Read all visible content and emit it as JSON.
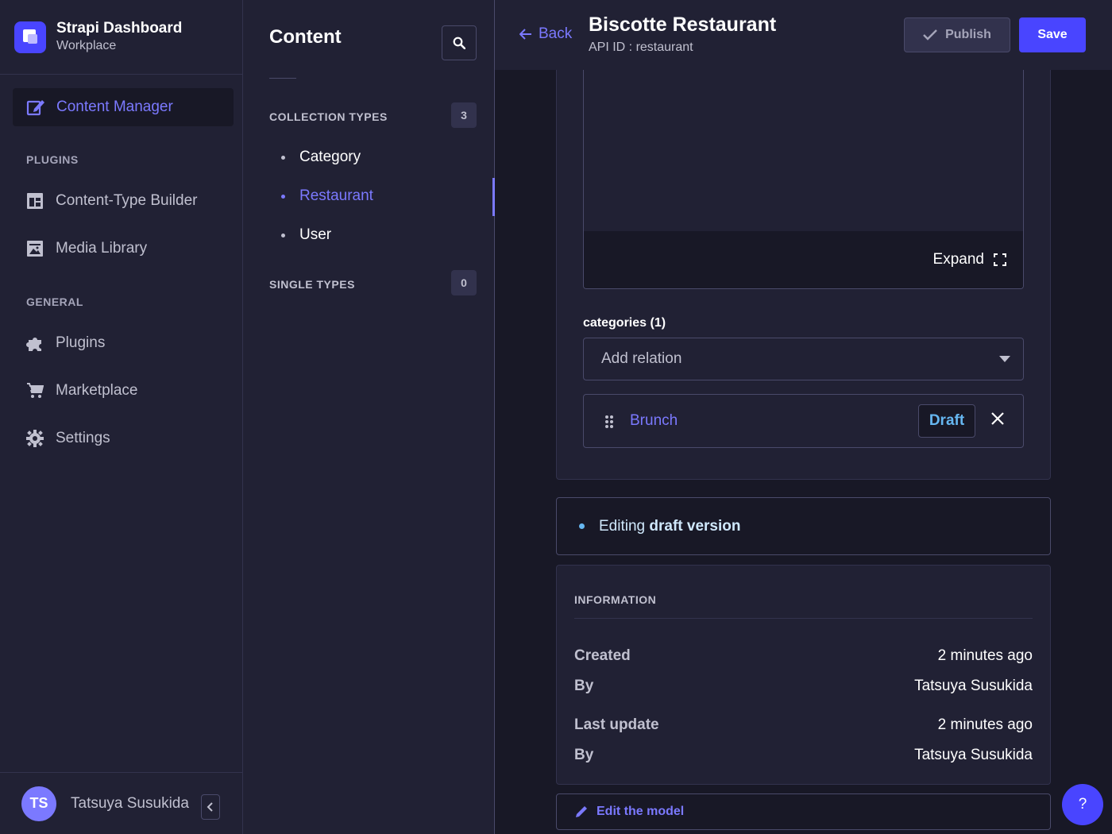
{
  "brand": {
    "title": "Strapi Dashboard",
    "subtitle": "Workplace"
  },
  "mainnav": {
    "active_item": "Content Manager",
    "plugins_heading": "PLUGINS",
    "plugins": [
      "Content-Type Builder",
      "Media Library"
    ],
    "general_heading": "GENERAL",
    "general": [
      "Plugins",
      "Marketplace",
      "Settings"
    ]
  },
  "user": {
    "initials": "TS",
    "name": "Tatsuya Susukida"
  },
  "subnav": {
    "title": "Content",
    "collection_heading": "COLLECTION TYPES",
    "collection_count": "3",
    "collection_items": [
      "Category",
      "Restaurant",
      "User"
    ],
    "active_item": "Restaurant",
    "single_heading": "SINGLE TYPES",
    "single_count": "0"
  },
  "header": {
    "back_label": "Back",
    "title": "Biscotte Restaurant",
    "api_id": "API ID : restaurant",
    "publish_label": "Publish",
    "save_label": "Save"
  },
  "editor": {
    "expand_label": "Expand"
  },
  "relation": {
    "label": "categories (1)",
    "placeholder": "Add relation",
    "items": [
      {
        "name": "Brunch",
        "status": "Draft"
      }
    ]
  },
  "status": {
    "prefix": "Editing ",
    "emphasis": "draft version"
  },
  "information": {
    "title": "INFORMATION",
    "rows": [
      {
        "key": "Created",
        "value": "2 minutes ago"
      },
      {
        "key": "By",
        "value": "Tatsuya Susukida"
      },
      {
        "key": "Last update",
        "value": "2 minutes ago"
      },
      {
        "key": "By",
        "value": "Tatsuya Susukida"
      }
    ]
  },
  "edit_model_label": "Edit the model",
  "help_label": "?",
  "colors": {
    "accent": "#4945ff",
    "accent_text": "#7b79ff",
    "draft": "#66b7f1",
    "bg": "#181826",
    "panel": "#212134"
  }
}
